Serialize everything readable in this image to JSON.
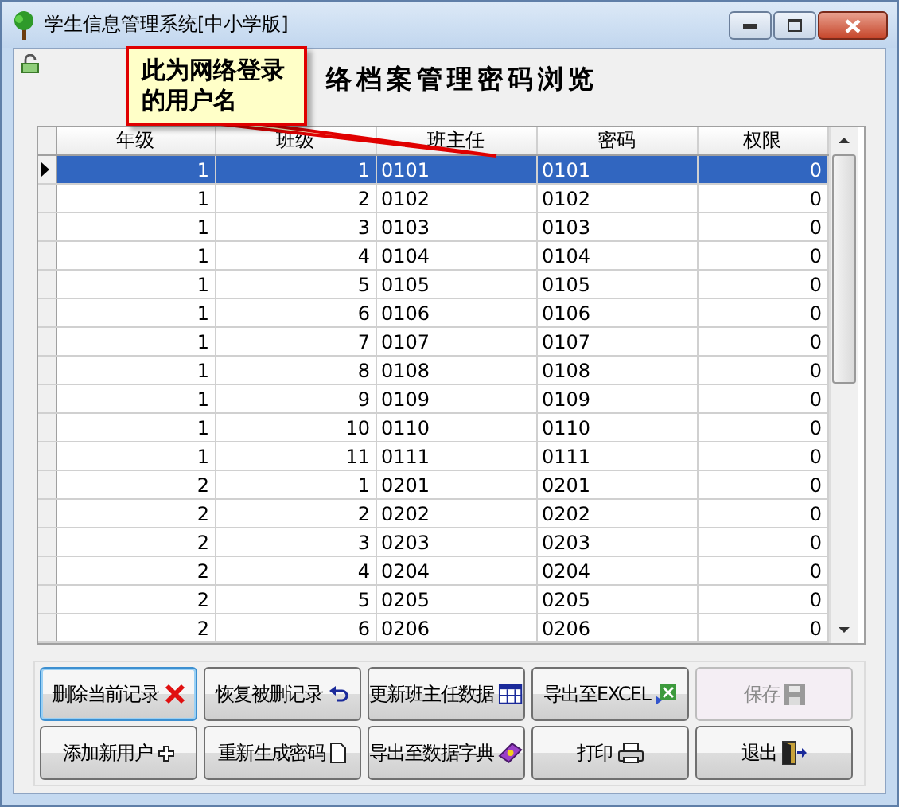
{
  "window": {
    "title": "学生信息管理系统[中小学版]"
  },
  "heading": "络档案管理密码浏览",
  "callout": {
    "text": "此为网络登录的用户名"
  },
  "table": {
    "columns": [
      "年级",
      "班级",
      "班主任",
      "密码",
      "权限"
    ],
    "rows": [
      {
        "cells": [
          "1",
          "1",
          "0101",
          "0101",
          "0"
        ],
        "selected": true
      },
      {
        "cells": [
          "1",
          "2",
          "0102",
          "0102",
          "0"
        ],
        "selected": false
      },
      {
        "cells": [
          "1",
          "3",
          "0103",
          "0103",
          "0"
        ],
        "selected": false
      },
      {
        "cells": [
          "1",
          "4",
          "0104",
          "0104",
          "0"
        ],
        "selected": false
      },
      {
        "cells": [
          "1",
          "5",
          "0105",
          "0105",
          "0"
        ],
        "selected": false
      },
      {
        "cells": [
          "1",
          "6",
          "0106",
          "0106",
          "0"
        ],
        "selected": false
      },
      {
        "cells": [
          "1",
          "7",
          "0107",
          "0107",
          "0"
        ],
        "selected": false
      },
      {
        "cells": [
          "1",
          "8",
          "0108",
          "0108",
          "0"
        ],
        "selected": false
      },
      {
        "cells": [
          "1",
          "9",
          "0109",
          "0109",
          "0"
        ],
        "selected": false
      },
      {
        "cells": [
          "1",
          "10",
          "0110",
          "0110",
          "0"
        ],
        "selected": false
      },
      {
        "cells": [
          "1",
          "11",
          "0111",
          "0111",
          "0"
        ],
        "selected": false
      },
      {
        "cells": [
          "2",
          "1",
          "0201",
          "0201",
          "0"
        ],
        "selected": false
      },
      {
        "cells": [
          "2",
          "2",
          "0202",
          "0202",
          "0"
        ],
        "selected": false
      },
      {
        "cells": [
          "2",
          "3",
          "0203",
          "0203",
          "0"
        ],
        "selected": false
      },
      {
        "cells": [
          "2",
          "4",
          "0204",
          "0204",
          "0"
        ],
        "selected": false
      },
      {
        "cells": [
          "2",
          "5",
          "0205",
          "0205",
          "0"
        ],
        "selected": false
      },
      {
        "cells": [
          "2",
          "6",
          "0206",
          "0206",
          "0"
        ],
        "selected": false
      }
    ]
  },
  "buttons": [
    {
      "label": "删除当前记录",
      "disabled": false
    },
    {
      "label": "恢复被删记录",
      "disabled": false
    },
    {
      "label": "更新班主任数据",
      "disabled": false
    },
    {
      "label": "导出至EXCEL",
      "disabled": false
    },
    {
      "label": "保存",
      "disabled": true
    },
    {
      "label": "添加新用户",
      "disabled": false
    },
    {
      "label": "重新生成密码",
      "disabled": false
    },
    {
      "label": "导出至数据字典",
      "disabled": false
    },
    {
      "label": "打印",
      "disabled": false
    },
    {
      "label": "退出",
      "disabled": false
    }
  ]
}
